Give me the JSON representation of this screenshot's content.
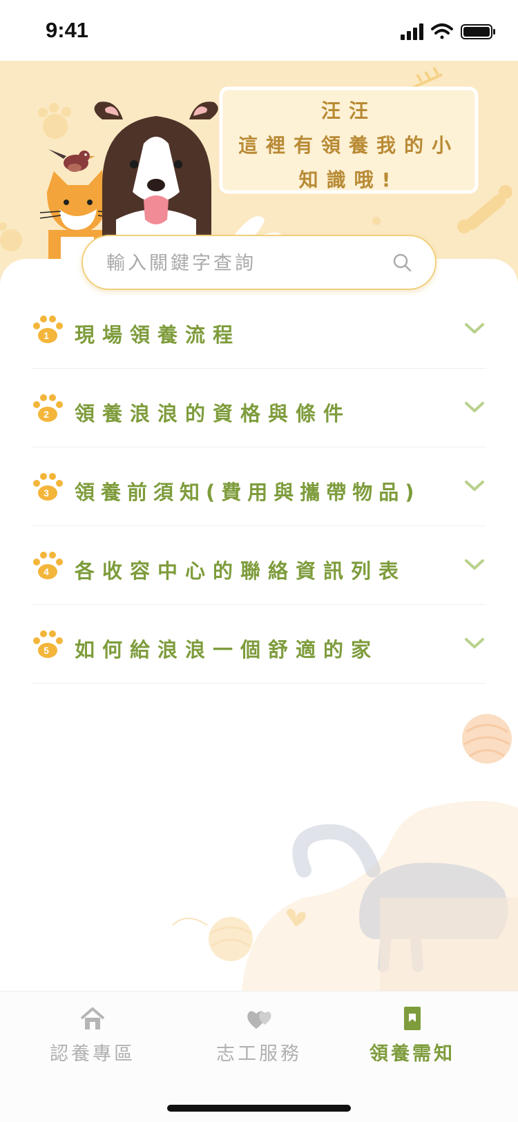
{
  "status_bar": {
    "time": "9:41"
  },
  "hero": {
    "bubble_lines": [
      "汪汪",
      "這裡有領養我的小",
      "知識哦!"
    ]
  },
  "search": {
    "placeholder": "輸入關鍵字查詢"
  },
  "faq": [
    {
      "num": "1",
      "label": "現場領養流程"
    },
    {
      "num": "2",
      "label": "領養浪浪的資格與條件"
    },
    {
      "num": "3",
      "label": "領養前須知(費用與攜帶物品)"
    },
    {
      "num": "4",
      "label": "各收容中心的聯絡資訊列表"
    },
    {
      "num": "5",
      "label": "如何給浪浪一個舒適的家"
    }
  ],
  "tabs": [
    {
      "label": "認養專區",
      "icon": "house-icon",
      "active": false
    },
    {
      "label": "志工服務",
      "icon": "hearts-icon",
      "active": false
    },
    {
      "label": "領養需知",
      "icon": "bookmark-book-icon",
      "active": true
    }
  ],
  "colors": {
    "accent_green": "#7e9c3c",
    "paw_orange": "#f3b53a",
    "hero_bg": "#fbe9c3",
    "bubble_text": "#b88a34"
  }
}
